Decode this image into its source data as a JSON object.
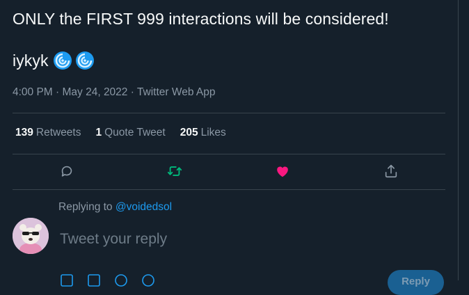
{
  "tweet": {
    "line1": "ONLY the FIRST 999 interactions will be considered!",
    "line2": "iykyk",
    "emoji": [
      "cyclone-icon",
      "cyclone-icon"
    ],
    "meta": "4:00 PM · May 24, 2022 · Twitter Web App"
  },
  "stats": [
    {
      "count": "139",
      "label": "Retweets"
    },
    {
      "count": "1",
      "label": "Quote Tweet"
    },
    {
      "count": "205",
      "label": "Likes"
    }
  ],
  "actions": {
    "reply": "reply-icon",
    "retweet": "retweet-icon",
    "like": "heart-icon",
    "share": "share-icon",
    "retweet_color": "#00ba7c",
    "like_color": "#f91880"
  },
  "reply": {
    "replying_prefix": "Replying to",
    "replying_to": "@voidedsol",
    "placeholder": "Tweet your reply",
    "button": "Reply"
  }
}
